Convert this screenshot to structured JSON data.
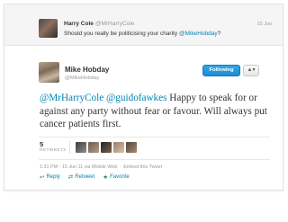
{
  "context_tweet": {
    "name": "Harry Cole",
    "handle": "@MrHarryCole",
    "time": "15 Jun",
    "text_prefix": "Should you really be politicising your charity ",
    "mention": "@MikeHobday",
    "text_suffix": "?"
  },
  "tweet": {
    "name": "Mike Hobday",
    "handle": "@MikeHobday",
    "follow_label": "Following",
    "user_menu_icon": "▲▾",
    "mention1": "@MrHarryCole",
    "mention2": "@guidofawkes",
    "text": " Happy to speak for or against any party without fear or favour. Will always put cancer patients first."
  },
  "stats": {
    "retweet_count": "5",
    "retweet_label": "RETWEETS"
  },
  "meta": {
    "timestamp": "1:31 PM - 15 Jun 11 via Mobile Web",
    "embed_label": "Embed this Tweet"
  },
  "actions": {
    "reply": "Reply",
    "retweet": "Retweet",
    "favorite": "Favorite"
  },
  "colors": {
    "link": "#0084b4",
    "follow_button": "#1d8fd4"
  }
}
